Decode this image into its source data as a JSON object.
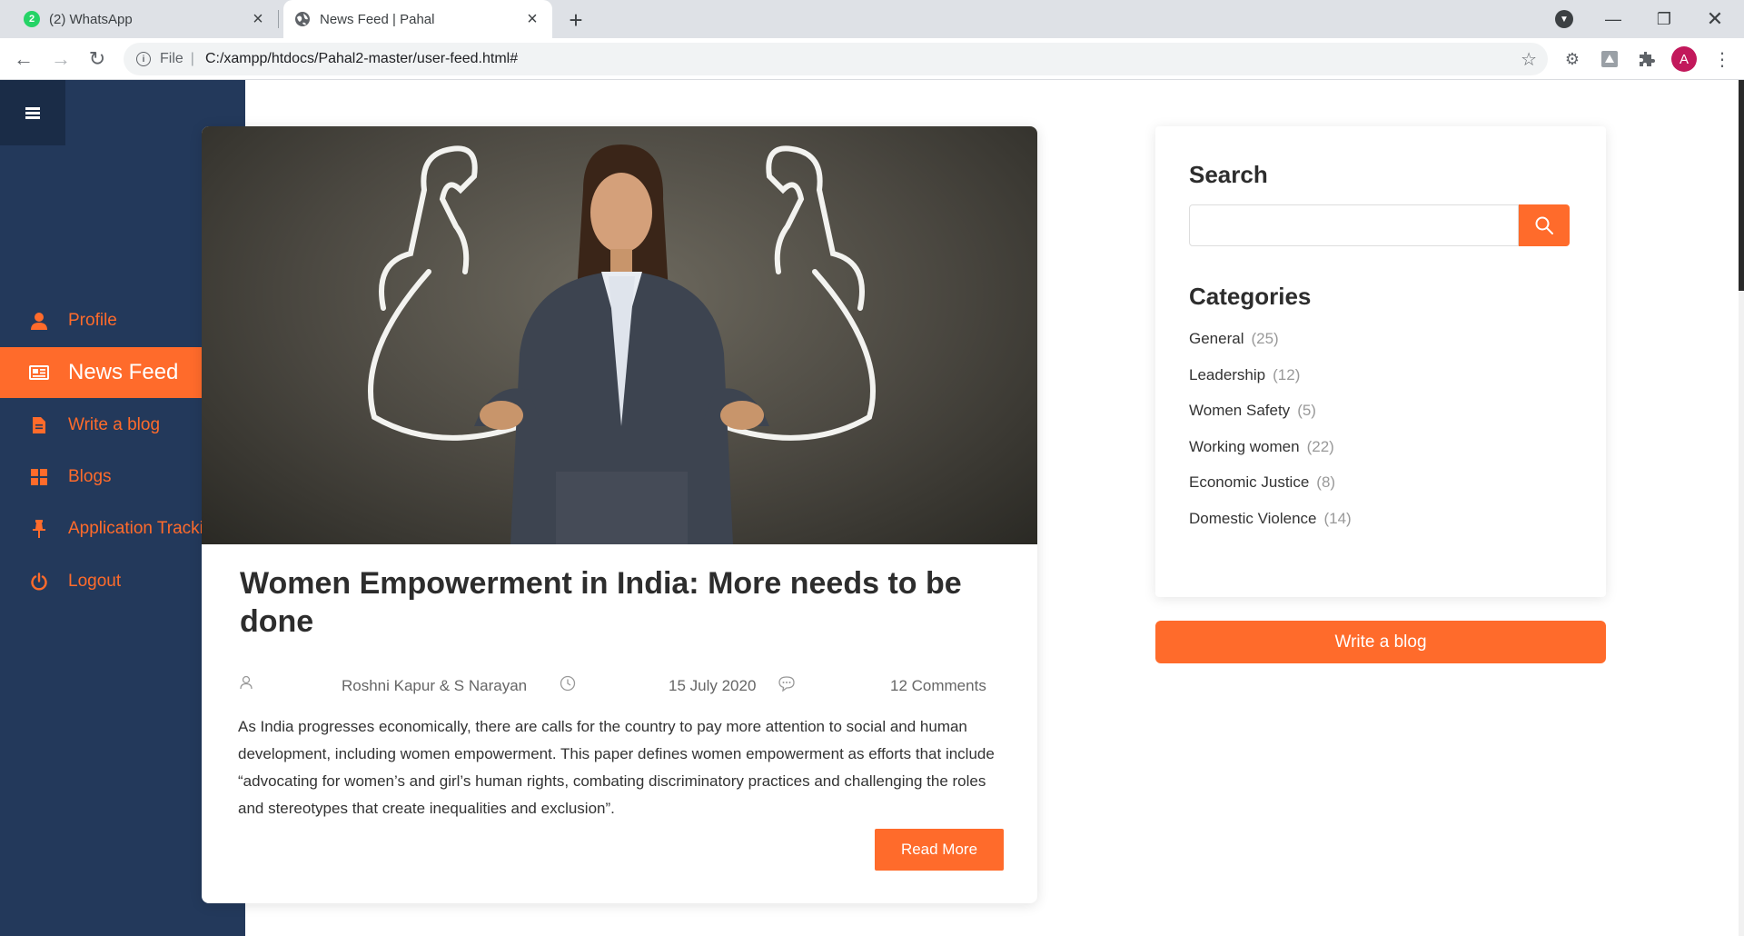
{
  "browser": {
    "tabs": [
      {
        "title": "(2) WhatsApp",
        "badge": "2",
        "active": false
      },
      {
        "title": "News Feed | Pahal",
        "active": true
      }
    ],
    "file_label": "File",
    "url": "C:/xampp/htdocs/Pahal2-master/user-feed.html#",
    "profile_initial": "A"
  },
  "sidebar": {
    "items": [
      {
        "label": "Profile",
        "icon": "user-icon"
      },
      {
        "label": "News Feed",
        "icon": "newspaper-icon",
        "active": true
      },
      {
        "label": "Write a blog",
        "icon": "document-icon"
      },
      {
        "label": "Blogs",
        "icon": "grid-icon"
      },
      {
        "label": "Application Tracking",
        "icon": "pin-icon"
      },
      {
        "label": "Logout",
        "icon": "power-icon"
      }
    ]
  },
  "post": {
    "title": "Women Empowerment in India: More needs to be done",
    "author": "Roshni Kapur & S Narayan",
    "date": "15 July 2020",
    "comments": "12 Comments",
    "excerpt": "As India progresses economically, there are calls for the country to pay more attention to social and human development, including women empowerment. This paper defines women empowerment as efforts that include “advocating for women’s and girl’s human rights, combating discriminatory practices and challenging the roles and stereotypes that create inequalities and exclusion”.",
    "read_more": "Read More"
  },
  "search": {
    "heading": "Search",
    "placeholder": ""
  },
  "categories": {
    "heading": "Categories",
    "items": [
      {
        "name": "General",
        "count": "(25)"
      },
      {
        "name": "Leadership",
        "count": "(12)"
      },
      {
        "name": "Women Safety",
        "count": "(5)"
      },
      {
        "name": "Working women",
        "count": "(22)"
      },
      {
        "name": "Economic Justice",
        "count": "(8)"
      },
      {
        "name": "Domestic Violence",
        "count": "(14)"
      }
    ]
  },
  "write_blog_button": "Write a blog",
  "colors": {
    "accent": "#ff6b2b",
    "sidebar": "#23395b",
    "sidebar_header": "#1a2c47"
  }
}
